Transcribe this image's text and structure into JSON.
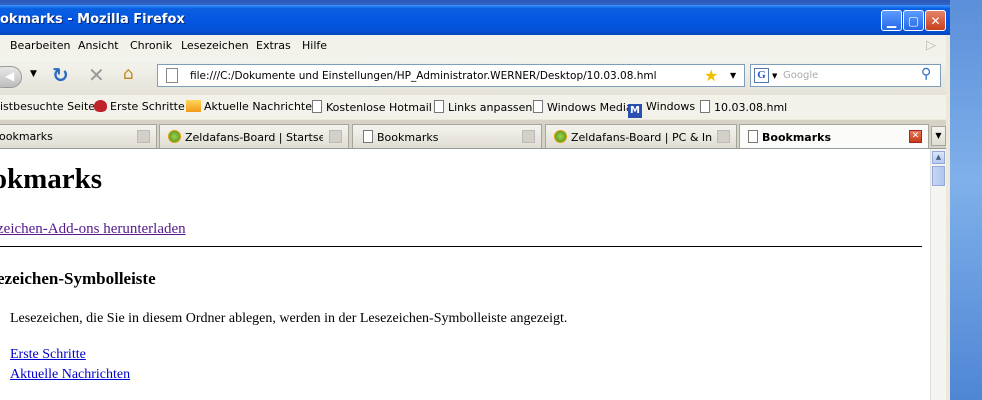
{
  "window": {
    "title": "okmarks - Mozilla Firefox"
  },
  "menu": [
    "Bearbeiten",
    "Ansicht",
    "Chronik",
    "Lesezeichen",
    "Extras",
    "Hilfe"
  ],
  "navbar": {
    "url": "file:///C:/Dokumente und Einstellungen/HP_Administrator.WERNER/Desktop/10.03.08.hml",
    "search_engine": "G",
    "search_placeholder": "Google"
  },
  "bookmarks": [
    "istbesuchte Seiten",
    "Erste Schritte",
    "Aktuelle Nachrichten",
    "Kostenlose Hotmail",
    "Links anpassen",
    "Windows Media",
    "Windows",
    "10.03.08.hml"
  ],
  "tabs": [
    {
      "label": "ookmarks",
      "active": false
    },
    {
      "label": "Zeldafans-Board | Startseite",
      "active": false
    },
    {
      "label": "Bookmarks",
      "active": false
    },
    {
      "label": "Zeldafans-Board | PC & Int...",
      "active": false
    },
    {
      "label": "Bookmarks",
      "active": true
    }
  ],
  "page": {
    "heading": "ookmarks",
    "addons_link": "zeichen-Add-ons herunterladen",
    "section_title": "ezeichen-Symbolleiste",
    "description": "Lesezeichen, die Sie in diesem Ordner ablegen, werden in der Lesezeichen-Symbolleiste angezeigt.",
    "links": [
      "Erste Schritte",
      "Aktuelle Nachrichten"
    ]
  },
  "colors": {
    "titlebar": "#0456e0",
    "link_visited": "#551a8b",
    "link_unvisited": "#0000cc",
    "desktop": "#3a6ea5"
  }
}
